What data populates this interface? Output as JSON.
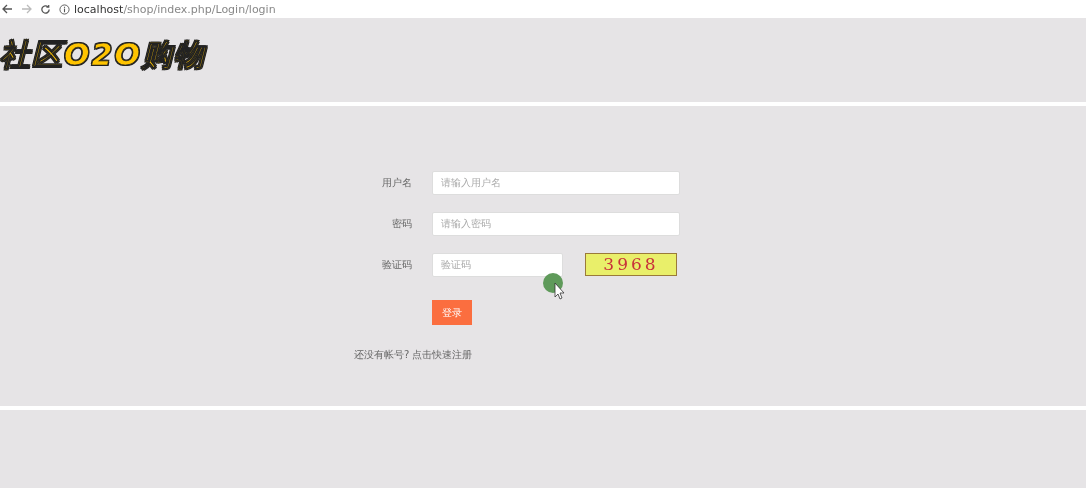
{
  "browser": {
    "url_host": "localhost",
    "url_path": "/shop/index.php/Login/login"
  },
  "logo": {
    "text": "社区O2O购物"
  },
  "form": {
    "fields": [
      {
        "label": "用户名",
        "placeholder": "请输入用户名",
        "kind": "text"
      },
      {
        "label": "密码",
        "placeholder": "请输入密码",
        "kind": "text"
      },
      {
        "label": "验证码",
        "placeholder": "验证码",
        "kind": "captcha",
        "captcha": "3968"
      }
    ],
    "submit": "登录",
    "register_prompt": "还没有帐号?",
    "register_link": "点击快速注册"
  }
}
